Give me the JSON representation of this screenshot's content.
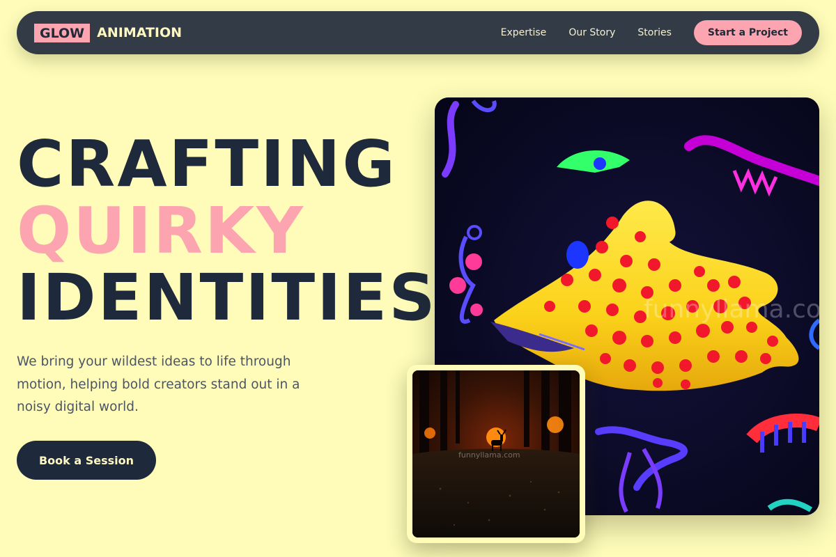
{
  "nav": {
    "logo_badge": "GLOW",
    "logo_text": "ANIMATION",
    "links": [
      "Expertise",
      "Our Story",
      "Stories"
    ],
    "cta": "Start a Project"
  },
  "hero": {
    "line1": "CRAFTING",
    "line2": "QUIRKY",
    "line3": "IDENTITIES",
    "line3_dot": ".",
    "description": "We bring your wildest ideas to life through motion, helping bold creators stand out in a noisy digital world.",
    "button": "Book a Session"
  },
  "images": {
    "main_watermark": "funnyllama.com",
    "thumb_watermark": "funnyllama.com"
  },
  "colors": {
    "background": "#fefcb8",
    "nav": "#333c46",
    "accent_pink": "#fca5b0",
    "dark": "#1e293b"
  }
}
